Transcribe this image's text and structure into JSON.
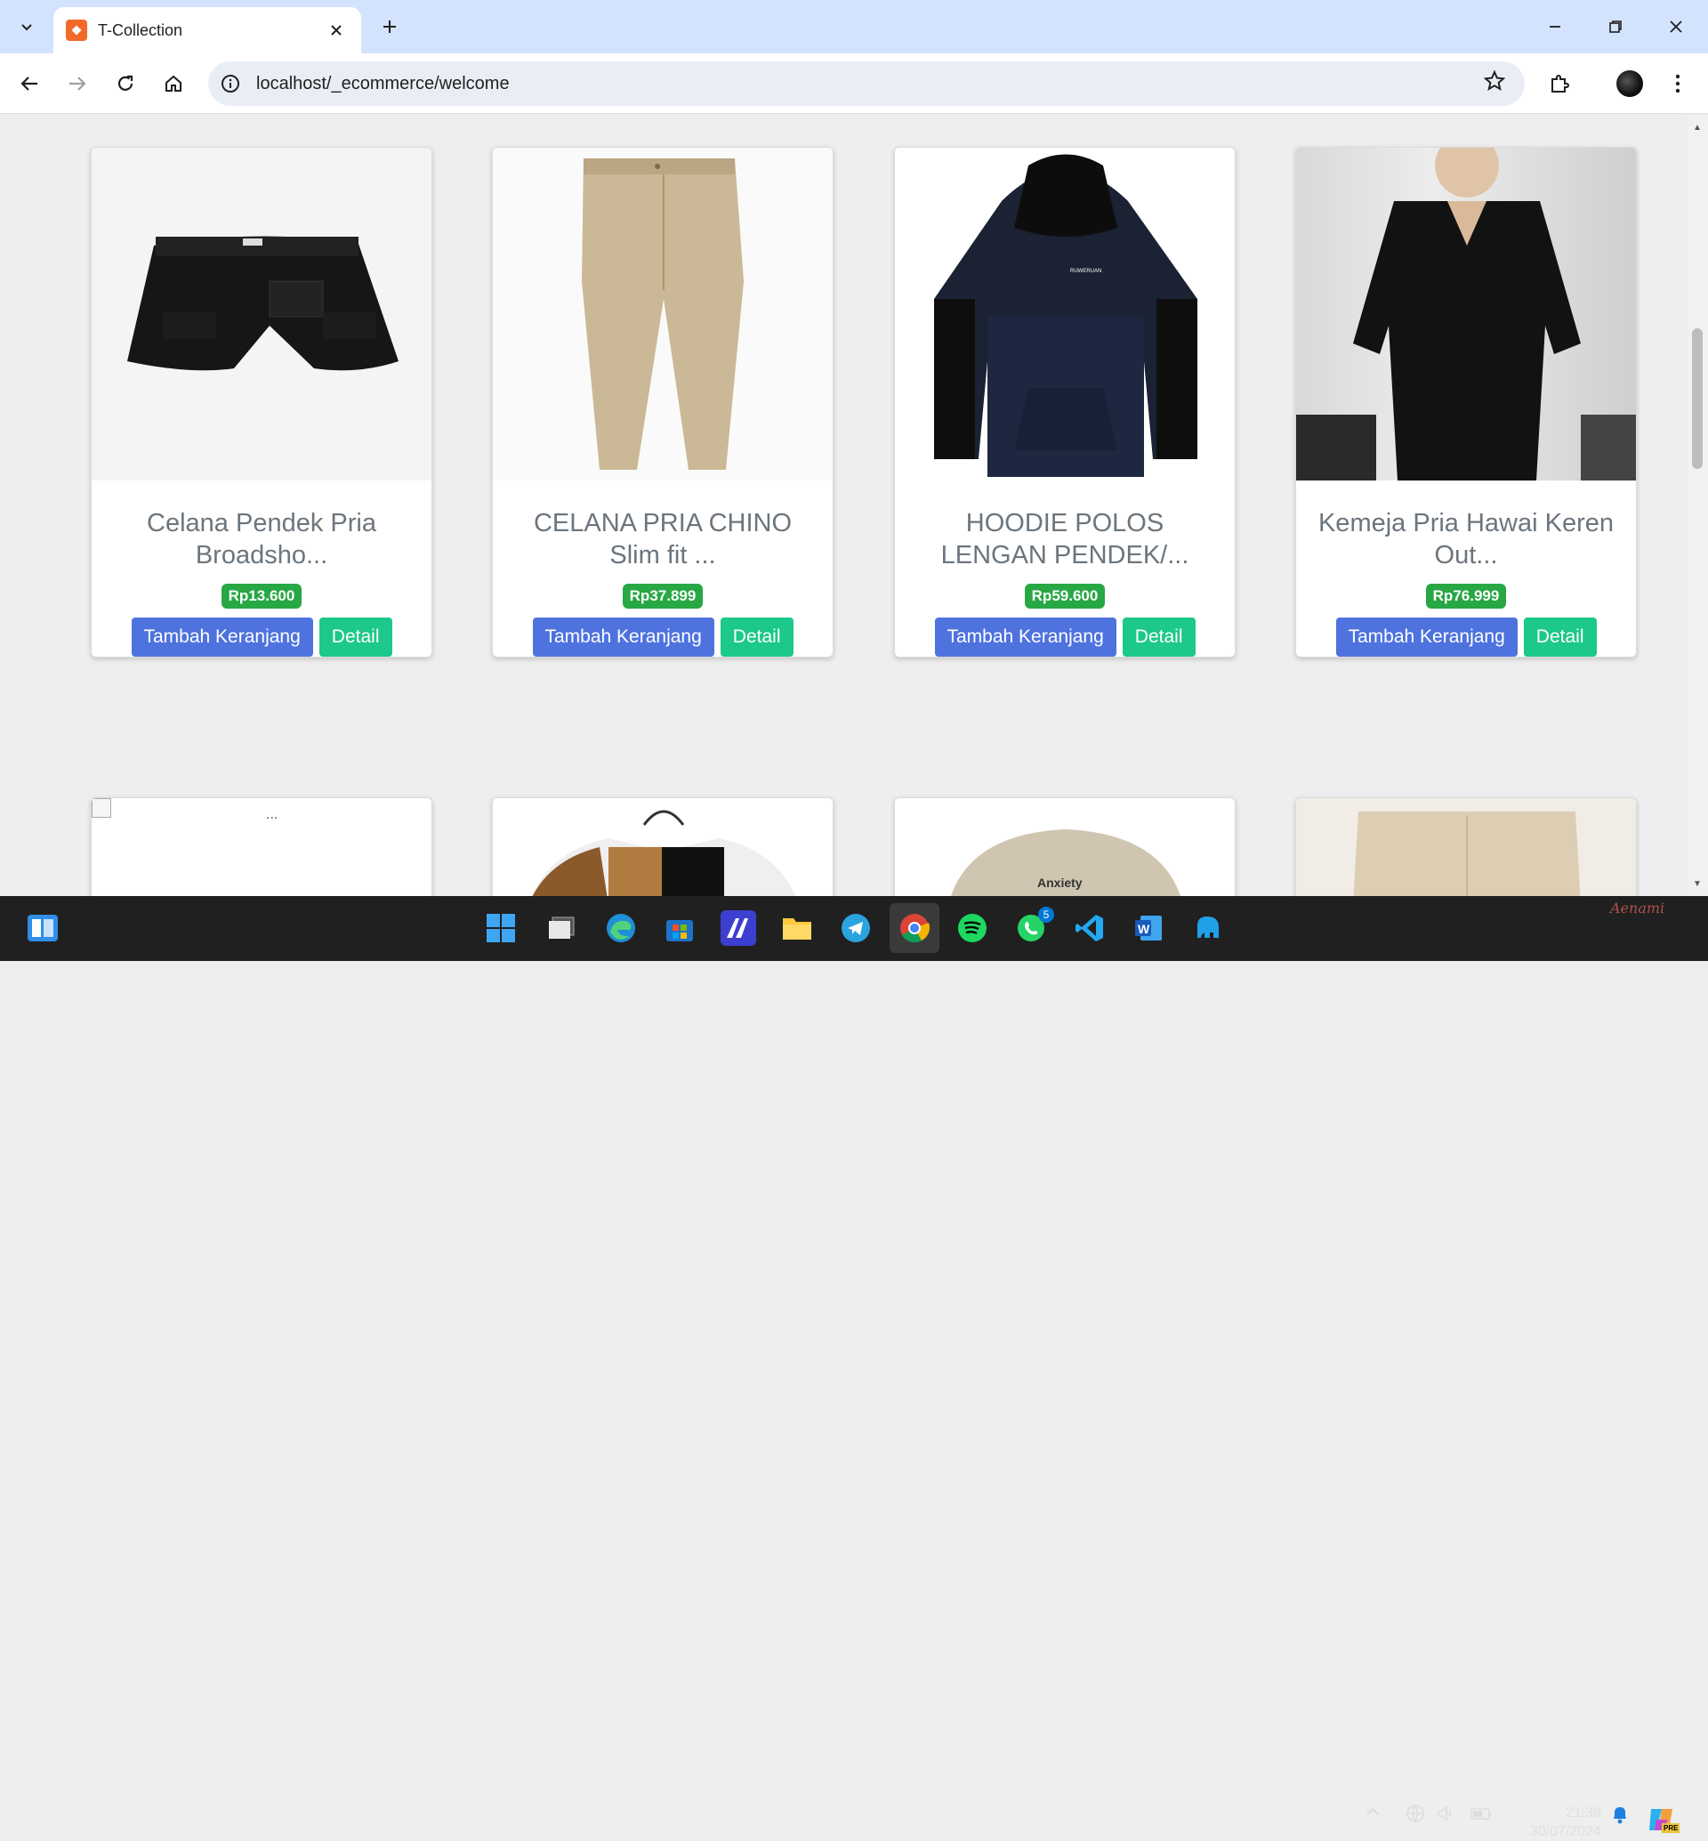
{
  "browser": {
    "tab_title": "T-Collection",
    "tab_favicon_glyph": "❖",
    "url": "localhost/_ecommerce/welcome",
    "icons": {
      "tab_dropdown": "chevron-down-icon",
      "close": "close-icon",
      "new_tab": "plus-icon",
      "back": "back-arrow-icon",
      "forward": "forward-arrow-icon",
      "reload": "reload-icon",
      "home": "home-icon",
      "site_info": "info-icon",
      "bookmark": "star-icon",
      "extensions": "puzzle-icon",
      "menu": "kebab-menu-icon"
    }
  },
  "products": [
    {
      "title": "Celana Pendek Pria Broadsho...",
      "price": "Rp13.600",
      "cart_label": "Tambah Keranjang",
      "detail_label": "Detail"
    },
    {
      "title": "CELANA PRIA CHINO Slim fit ...",
      "price": "Rp37.899",
      "cart_label": "Tambah Keranjang",
      "detail_label": "Detail"
    },
    {
      "title": "HOODIE POLOS LENGAN PENDEK/...",
      "price": "Rp59.600",
      "cart_label": "Tambah Keranjang",
      "detail_label": "Detail"
    },
    {
      "title": "Kemeja Pria Hawai Keren Out...",
      "price": "Rp76.999",
      "cart_label": "Tambah Keranjang",
      "detail_label": "Detail"
    }
  ],
  "second_row": {
    "broken_image_alt": "..."
  },
  "hoodie_brand_text": "RUWERUAN",
  "cap_text": "Anxiety",
  "taskbar": {
    "clock_time": "21:39",
    "clock_date": "30/07/2024",
    "whatsapp_badge": "5",
    "word_glyph": "W",
    "pre_badge": "PRE",
    "signature": "Aenami"
  },
  "colors": {
    "cart_button": "#4e73df",
    "detail_button": "#1cc88a",
    "price_badge": "#28a745",
    "title_text": "#6c757d"
  }
}
